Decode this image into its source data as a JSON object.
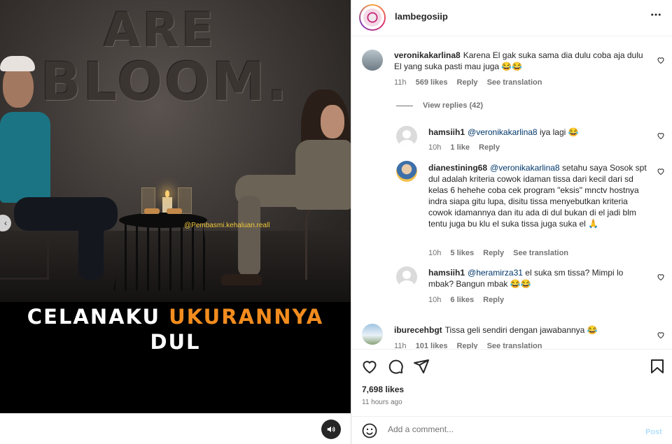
{
  "media": {
    "wall_text_line1": "ARE",
    "wall_text_line2": "BLOOM.",
    "watermark": "@Pembasmi.kehaluan.reall",
    "caption_line1_white": "CELANAKU",
    "caption_line1_orange": "UKURANNYA",
    "caption_line2": "DUL"
  },
  "header": {
    "username": "lambegosiip",
    "more_icon": "more-horizontal-icon"
  },
  "comments": [
    {
      "username": "veronikakarlina8",
      "text": "Karena El gak suka sama dia dulu coba aja dulu El yang suka pasti mau juga 😂😂",
      "time": "11h",
      "likes": "569 likes",
      "reply": "Reply",
      "translate": "See translation"
    },
    {
      "username": "hamsiih1",
      "mention": "@veronikakarlina8",
      "text": "iya lagi 😂",
      "time": "10h",
      "likes": "1 like",
      "reply": "Reply"
    },
    {
      "username": "dianestining68",
      "mention": "@veronikakarlina8",
      "text": "setahu saya Sosok spt dul adalah kriteria cowok idaman tissa dari kecil dari sd kelas 6 hehehe coba cek program \"eksis\" mnctv hostnya indra siapa gitu lupa, disitu tissa menyebutkan kriteria cowok idamannya dan itu ada di dul bukan di el jadi blm tentu juga bu klu el suka tissa juga suka el 🙏",
      "time": "10h",
      "likes": "5 likes",
      "reply": "Reply",
      "translate": "See translation"
    },
    {
      "username": "hamsiih1",
      "mention": "@heramirza31",
      "text": "el suka sm tissa? Mimpi lo mbak? Bangun mbak 😂😂",
      "time": "10h",
      "likes": "6 likes",
      "reply": "Reply"
    },
    {
      "username": "iburecehbgt",
      "text": "Tissa geli sendiri dengan jawabannya 😂",
      "time": "11h",
      "likes": "101 likes",
      "reply": "Reply",
      "translate": "See translation"
    }
  ],
  "view_replies": "View replies (42)",
  "actions": {
    "like_icon": "heart-icon",
    "comment_icon": "comment-icon",
    "share_icon": "share-icon",
    "save_icon": "bookmark-icon"
  },
  "likes": "7,698 likes",
  "posted": "11 hours ago",
  "add_comment": {
    "placeholder": "Add a comment...",
    "post_label": "Post"
  },
  "colors": {
    "caption_orange": "#f28c1e",
    "watermark_yellow": "#f0c93a",
    "mention_blue": "#00376b",
    "post_disabled": "#b2dffc"
  }
}
